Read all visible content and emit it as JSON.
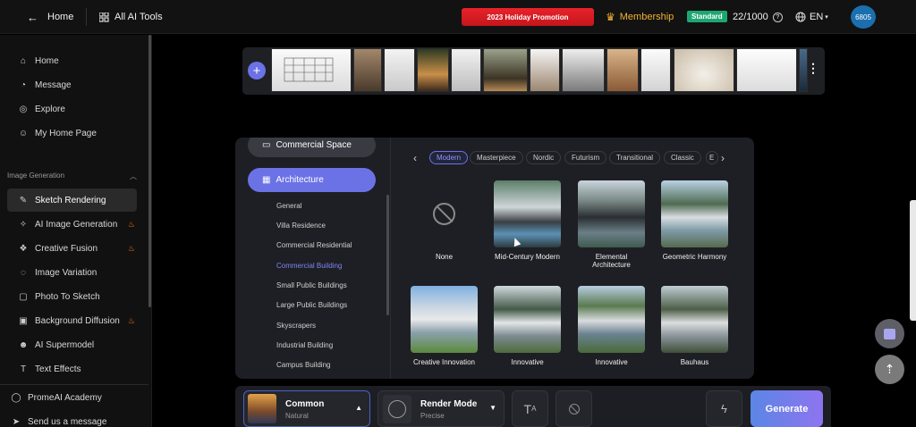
{
  "topbar": {
    "home_label": "Home",
    "all_tools_label": "All AI Tools",
    "promo_label": "2023 Holiday Promotion",
    "membership_label": "Membership",
    "plan_badge": "Standard",
    "credits": "22/1000",
    "language": "EN",
    "avatar_text": "6805",
    "colors": {
      "promo": "#e8222a",
      "plan": "#1ea672",
      "avatar": "#1b6fae",
      "crown": "#f2b233"
    }
  },
  "sidebar": {
    "items": [
      {
        "label": "Home",
        "icon": "home-icon"
      },
      {
        "label": "Message",
        "icon": "bell-icon"
      },
      {
        "label": "Explore",
        "icon": "compass-icon"
      },
      {
        "label": "My Home Page",
        "icon": "user-icon"
      }
    ],
    "section_title": "Image Generation",
    "tools": [
      {
        "label": "Sketch Rendering",
        "icon": "sketch-icon",
        "active": true,
        "hot": false
      },
      {
        "label": "AI Image Generation",
        "icon": "image-icon",
        "hot": true
      },
      {
        "label": "Creative Fusion",
        "icon": "fusion-icon",
        "hot": true
      },
      {
        "label": "Image Variation",
        "icon": "variation-icon",
        "hot": false
      },
      {
        "label": "Photo To Sketch",
        "icon": "photo-icon",
        "hot": false
      },
      {
        "label": "Background Diffusion",
        "icon": "background-icon",
        "hot": true
      },
      {
        "label": "AI Supermodel",
        "icon": "model-icon",
        "hot": false
      },
      {
        "label": "Text Effects",
        "icon": "text-icon",
        "hot": false
      }
    ],
    "footer": [
      {
        "label": "PromeAI Academy",
        "icon": "academy-icon"
      },
      {
        "label": "Send us a message",
        "icon": "send-icon"
      }
    ]
  },
  "panel": {
    "categories": [
      {
        "label": "Commercial Space",
        "icon": "building-icon",
        "active": false
      },
      {
        "label": "Architecture",
        "icon": "architecture-icon",
        "active": true
      }
    ],
    "subcategories": [
      "General",
      "Villa Residence",
      "Commercial Residential",
      "Commercial Building",
      "Small Public Buildings",
      "Large Public Buildings",
      "Skyscrapers",
      "Industrial Building",
      "Campus Building"
    ],
    "active_subcategory": "Commercial Building",
    "style_chips": [
      "Modern",
      "Masterpiece",
      "Nordic",
      "Futurism",
      "Transitional",
      "Classic",
      "E"
    ],
    "active_chip": "Modern",
    "styles": [
      {
        "label": "None"
      },
      {
        "label": "Mid-Century Modern"
      },
      {
        "label": "Elemental Architecture"
      },
      {
        "label": "Geometric Harmony"
      },
      {
        "label": "Creative Innovation"
      },
      {
        "label": "Innovative"
      },
      {
        "label": "Innovative"
      },
      {
        "label": "Bauhaus"
      }
    ],
    "accent_color": "#6b72e6"
  },
  "bottombar": {
    "model_title": "Common",
    "model_sub": "Natural",
    "mode_title": "Render Mode",
    "mode_sub": "Precise",
    "generate_label": "Generate"
  }
}
